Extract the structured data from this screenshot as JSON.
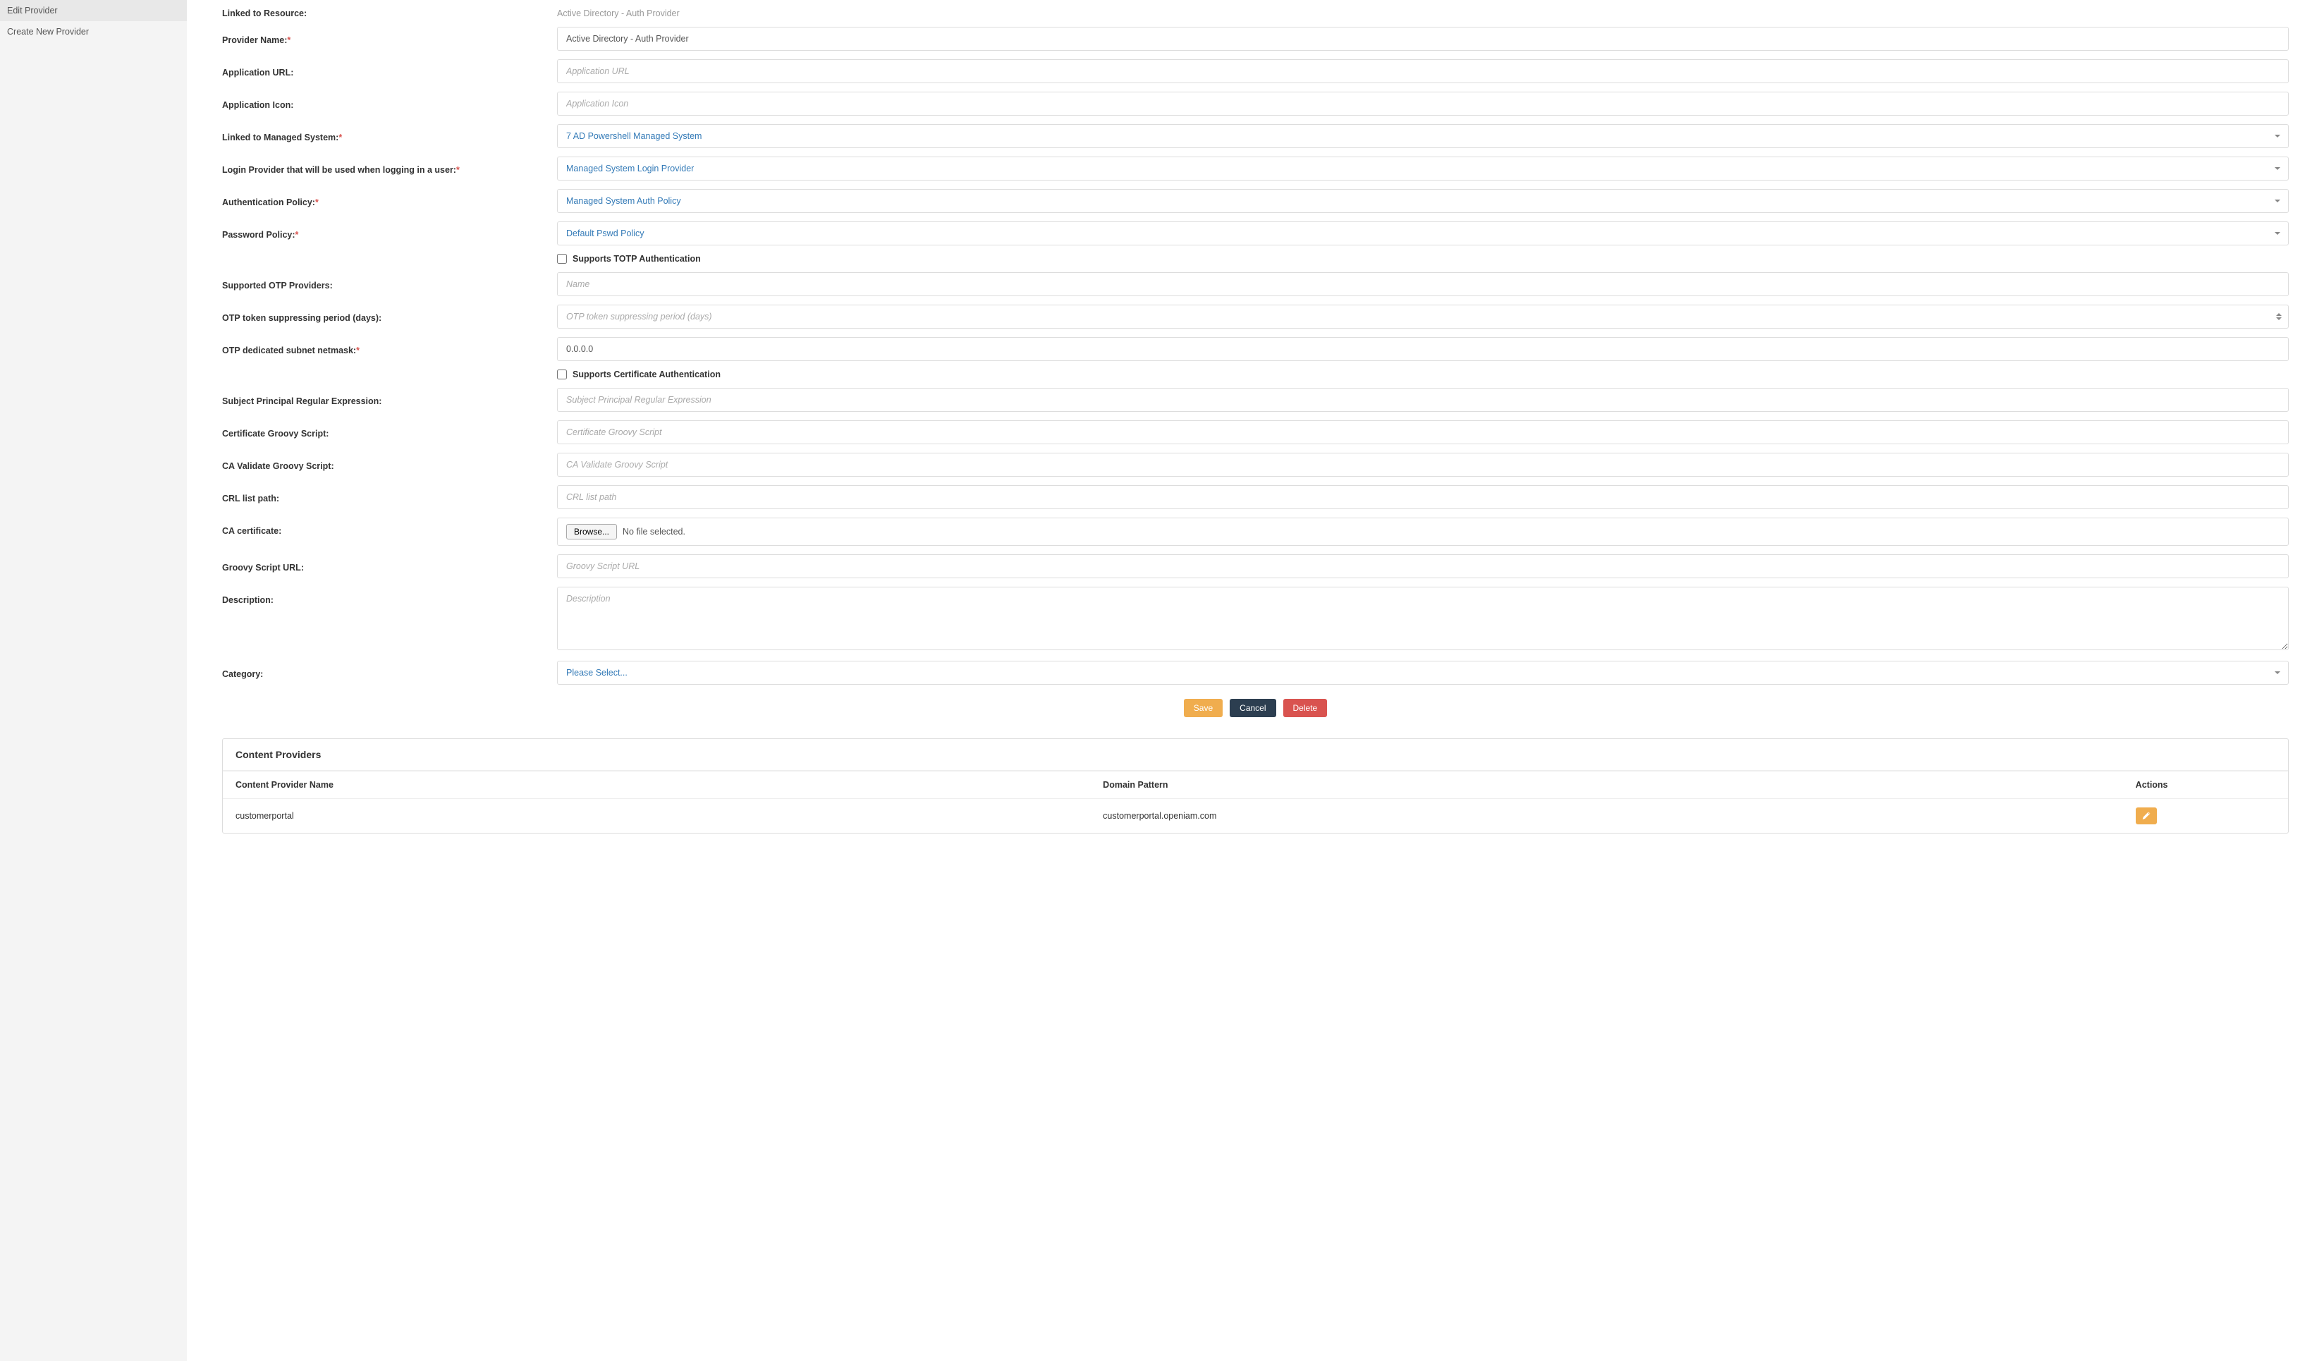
{
  "sidebar": {
    "items": [
      {
        "label": "Edit Provider"
      },
      {
        "label": "Create New Provider"
      }
    ]
  },
  "form": {
    "linked_resource": {
      "label": "Linked to Resource:",
      "value": "Active Directory - Auth Provider"
    },
    "provider_name": {
      "label": "Provider Name:",
      "value": "Active Directory - Auth Provider"
    },
    "application_url": {
      "label": "Application URL:",
      "placeholder": "Application URL",
      "value": ""
    },
    "application_icon": {
      "label": "Application Icon:",
      "placeholder": "Application Icon",
      "value": ""
    },
    "linked_managed_system": {
      "label": "Linked to Managed System:",
      "value": "7 AD Powershell Managed System"
    },
    "login_provider": {
      "label": "Login Provider that will be used when logging in a user:",
      "value": "Managed System Login Provider"
    },
    "auth_policy": {
      "label": "Authentication Policy:",
      "value": "Managed System Auth Policy"
    },
    "password_policy": {
      "label": "Password Policy:",
      "value": "Default Pswd Policy"
    },
    "supports_totp": {
      "label": "Supports TOTP Authentication"
    },
    "supported_otp_providers": {
      "label": "Supported OTP Providers:",
      "placeholder": "Name",
      "value": ""
    },
    "otp_suppress_period": {
      "label": "OTP token suppressing period (days):",
      "placeholder": "OTP token suppressing period (days)",
      "value": ""
    },
    "otp_subnet": {
      "label": "OTP dedicated subnet netmask:",
      "value": "0.0.0.0"
    },
    "supports_cert": {
      "label": "Supports Certificate Authentication"
    },
    "subject_regex": {
      "label": "Subject Principal Regular Expression:",
      "placeholder": "Subject Principal Regular Expression",
      "value": ""
    },
    "cert_groovy": {
      "label": "Certificate Groovy Script:",
      "placeholder": "Certificate Groovy Script",
      "value": ""
    },
    "ca_validate_groovy": {
      "label": "CA Validate Groovy Script:",
      "placeholder": "CA Validate Groovy Script",
      "value": ""
    },
    "crl_list_path": {
      "label": "CRL list path:",
      "placeholder": "CRL list path",
      "value": ""
    },
    "ca_certificate": {
      "label": "CA certificate:",
      "browse": "Browse...",
      "status": "No file selected."
    },
    "groovy_script_url": {
      "label": "Groovy Script URL:",
      "placeholder": "Groovy Script URL",
      "value": ""
    },
    "description": {
      "label": "Description:",
      "placeholder": "Description",
      "value": ""
    },
    "category": {
      "label": "Category:",
      "value": "Please Select..."
    }
  },
  "buttons": {
    "save": "Save",
    "cancel": "Cancel",
    "delete": "Delete"
  },
  "content_providers": {
    "title": "Content Providers",
    "columns": {
      "name": "Content Provider Name",
      "domain": "Domain Pattern",
      "actions": "Actions"
    },
    "rows": [
      {
        "name": "customerportal",
        "domain": "customerportal.openiam.com"
      }
    ]
  }
}
